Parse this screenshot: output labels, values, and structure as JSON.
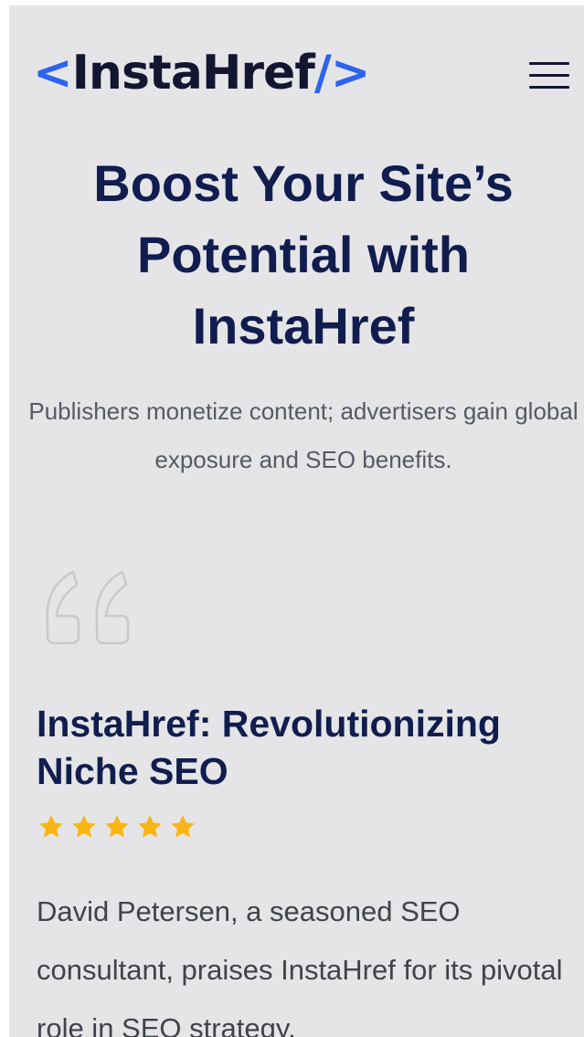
{
  "header": {
    "logo": {
      "open_bracket": "<",
      "name": "InstaHref",
      "close_bracket": "/>"
    },
    "menu_icon": "hamburger-menu-icon"
  },
  "hero": {
    "title": "Boost Your Site’s Potential with InstaHref",
    "subtitle": "Publishers monetize content; advertisers gain global exposure and SEO benefits."
  },
  "testimonial": {
    "quote_icon": "quote-mark-icon",
    "title": "InstaHref: Revolutionizing Niche SEO",
    "rating": 5,
    "rating_max": 5,
    "text": "David Petersen, a seasoned SEO consultant, praises InstaHref for its pivotal role in SEO strategy."
  },
  "colors": {
    "background": "#e5e5e8",
    "brand_blue": "#2d63f0",
    "logo_text": "#141530",
    "heading_navy": "#101d4e",
    "body_gray": "#555a63",
    "star_gold": "#f8b514"
  }
}
